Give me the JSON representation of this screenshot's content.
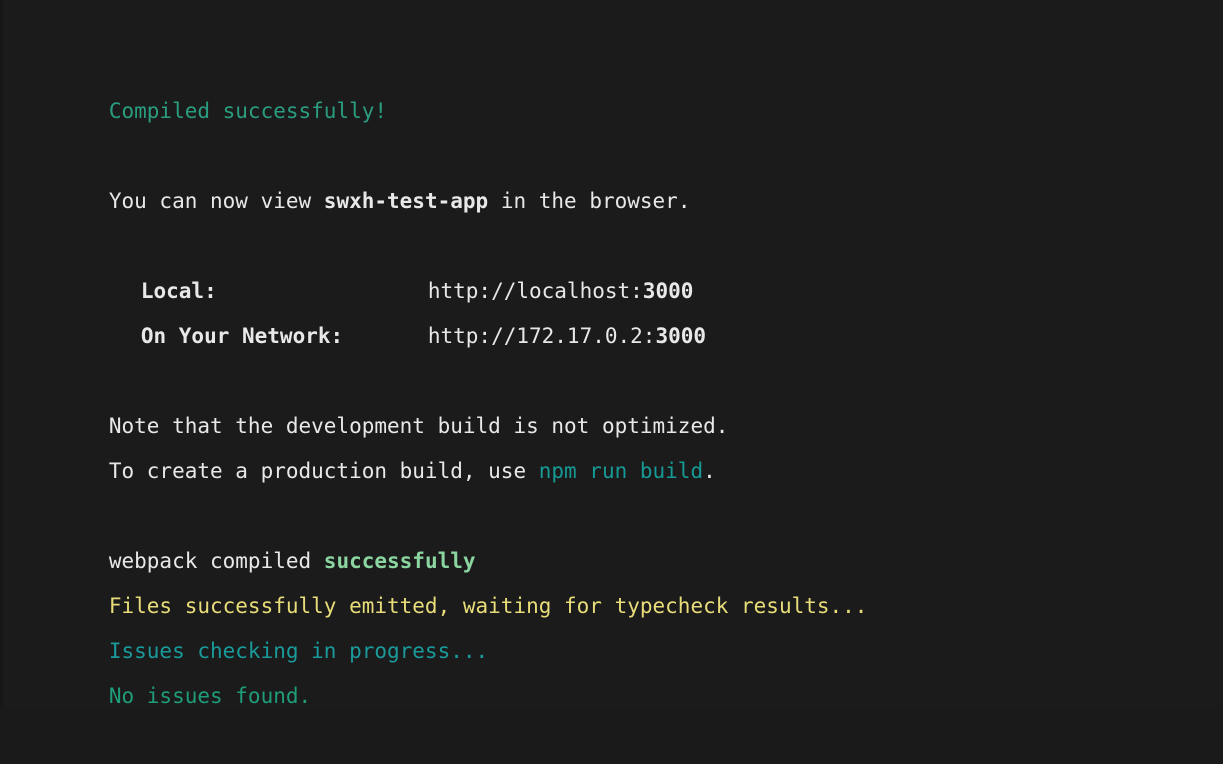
{
  "terminal": {
    "background_color": "#1b1b1b",
    "default_text_color": "#e8e8e8",
    "colors": {
      "teal": "#2a9d80",
      "cyan": "#169a95",
      "cyan_progress": "#1a9a9a",
      "green": "#1f9c7a",
      "light_green": "#8bd5a0",
      "yellow": "#e9dd79",
      "white": "#e8e8e8"
    }
  },
  "output": {
    "compiled_banner": "Compiled successfully!",
    "view_line": {
      "prefix": "You can now view ",
      "app_name": "swxh-test-app",
      "suffix": " in the browser."
    },
    "addresses": [
      {
        "label": "Local:",
        "url_scheme_host": "http://localhost:",
        "url_port": "3000"
      },
      {
        "label": "On Your Network:",
        "url_scheme_host": "http://172.17.0.2:",
        "url_port": "3000"
      }
    ],
    "note_line": "Note that the development build is not optimized.",
    "production_line": {
      "prefix": "To create a production build, use ",
      "command": "npm run build",
      "suffix": "."
    },
    "webpack_line": {
      "prefix": "webpack compiled ",
      "status": "successfully"
    },
    "emitted_line": "Files successfully emitted, waiting for typecheck results...",
    "checking_line": "Issues checking in progress...",
    "no_issues_line": "No issues found."
  }
}
